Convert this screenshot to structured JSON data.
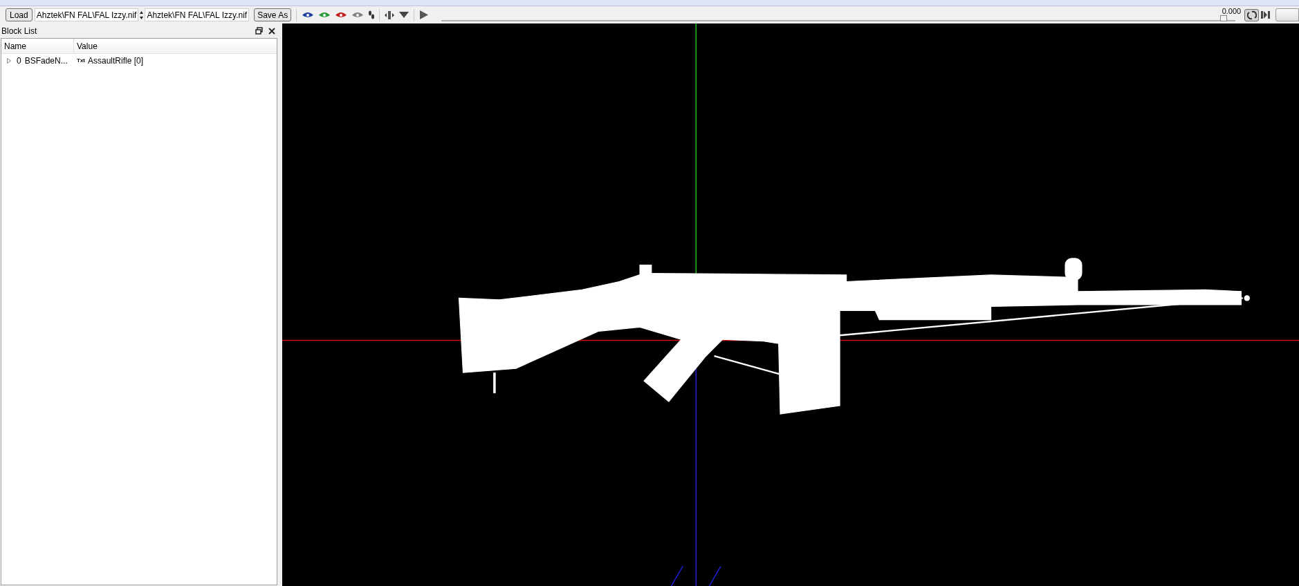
{
  "toolbar": {
    "load_button": "Load",
    "file_fields": [
      {
        "value": "Ahztek\\FN FAL\\FAL Izzy.nif"
      },
      {
        "value": "Ahztek\\FN FAL\\FAL Izzy.nif"
      }
    ],
    "save_button": "Save As"
  },
  "animation": {
    "time": "0.000",
    "level": 0.985,
    "loop_on": true
  },
  "block_list": {
    "title": "Block List",
    "columns": [
      "Name",
      "Value"
    ],
    "rows": [
      {
        "number": "0",
        "name": "BSFadeN...",
        "type_badge": "Txt",
        "value": "AssaultRifle [0]",
        "expanded": false
      }
    ]
  }
}
